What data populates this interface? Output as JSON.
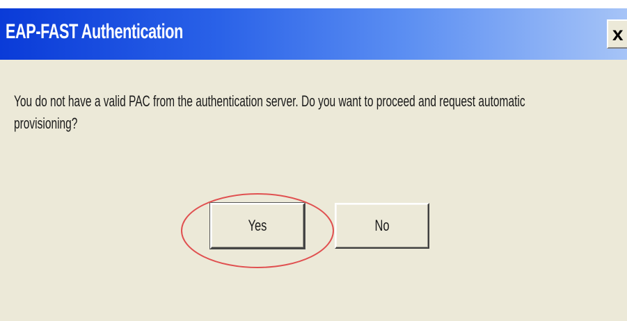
{
  "dialog": {
    "title": "EAP-FAST Authentication",
    "close_label": "x",
    "message": "You do not have a valid PAC from the authentication server. Do you want to proceed and request automatic provisioning?",
    "yes_label": "Yes",
    "no_label": "No"
  },
  "colors": {
    "titlebar_start": "#0a3bd8",
    "titlebar_end": "#a6c4f7",
    "dialog_background": "#ece9d8",
    "highlight_ellipse": "#e05050"
  },
  "icons": {
    "close": "close-icon"
  }
}
